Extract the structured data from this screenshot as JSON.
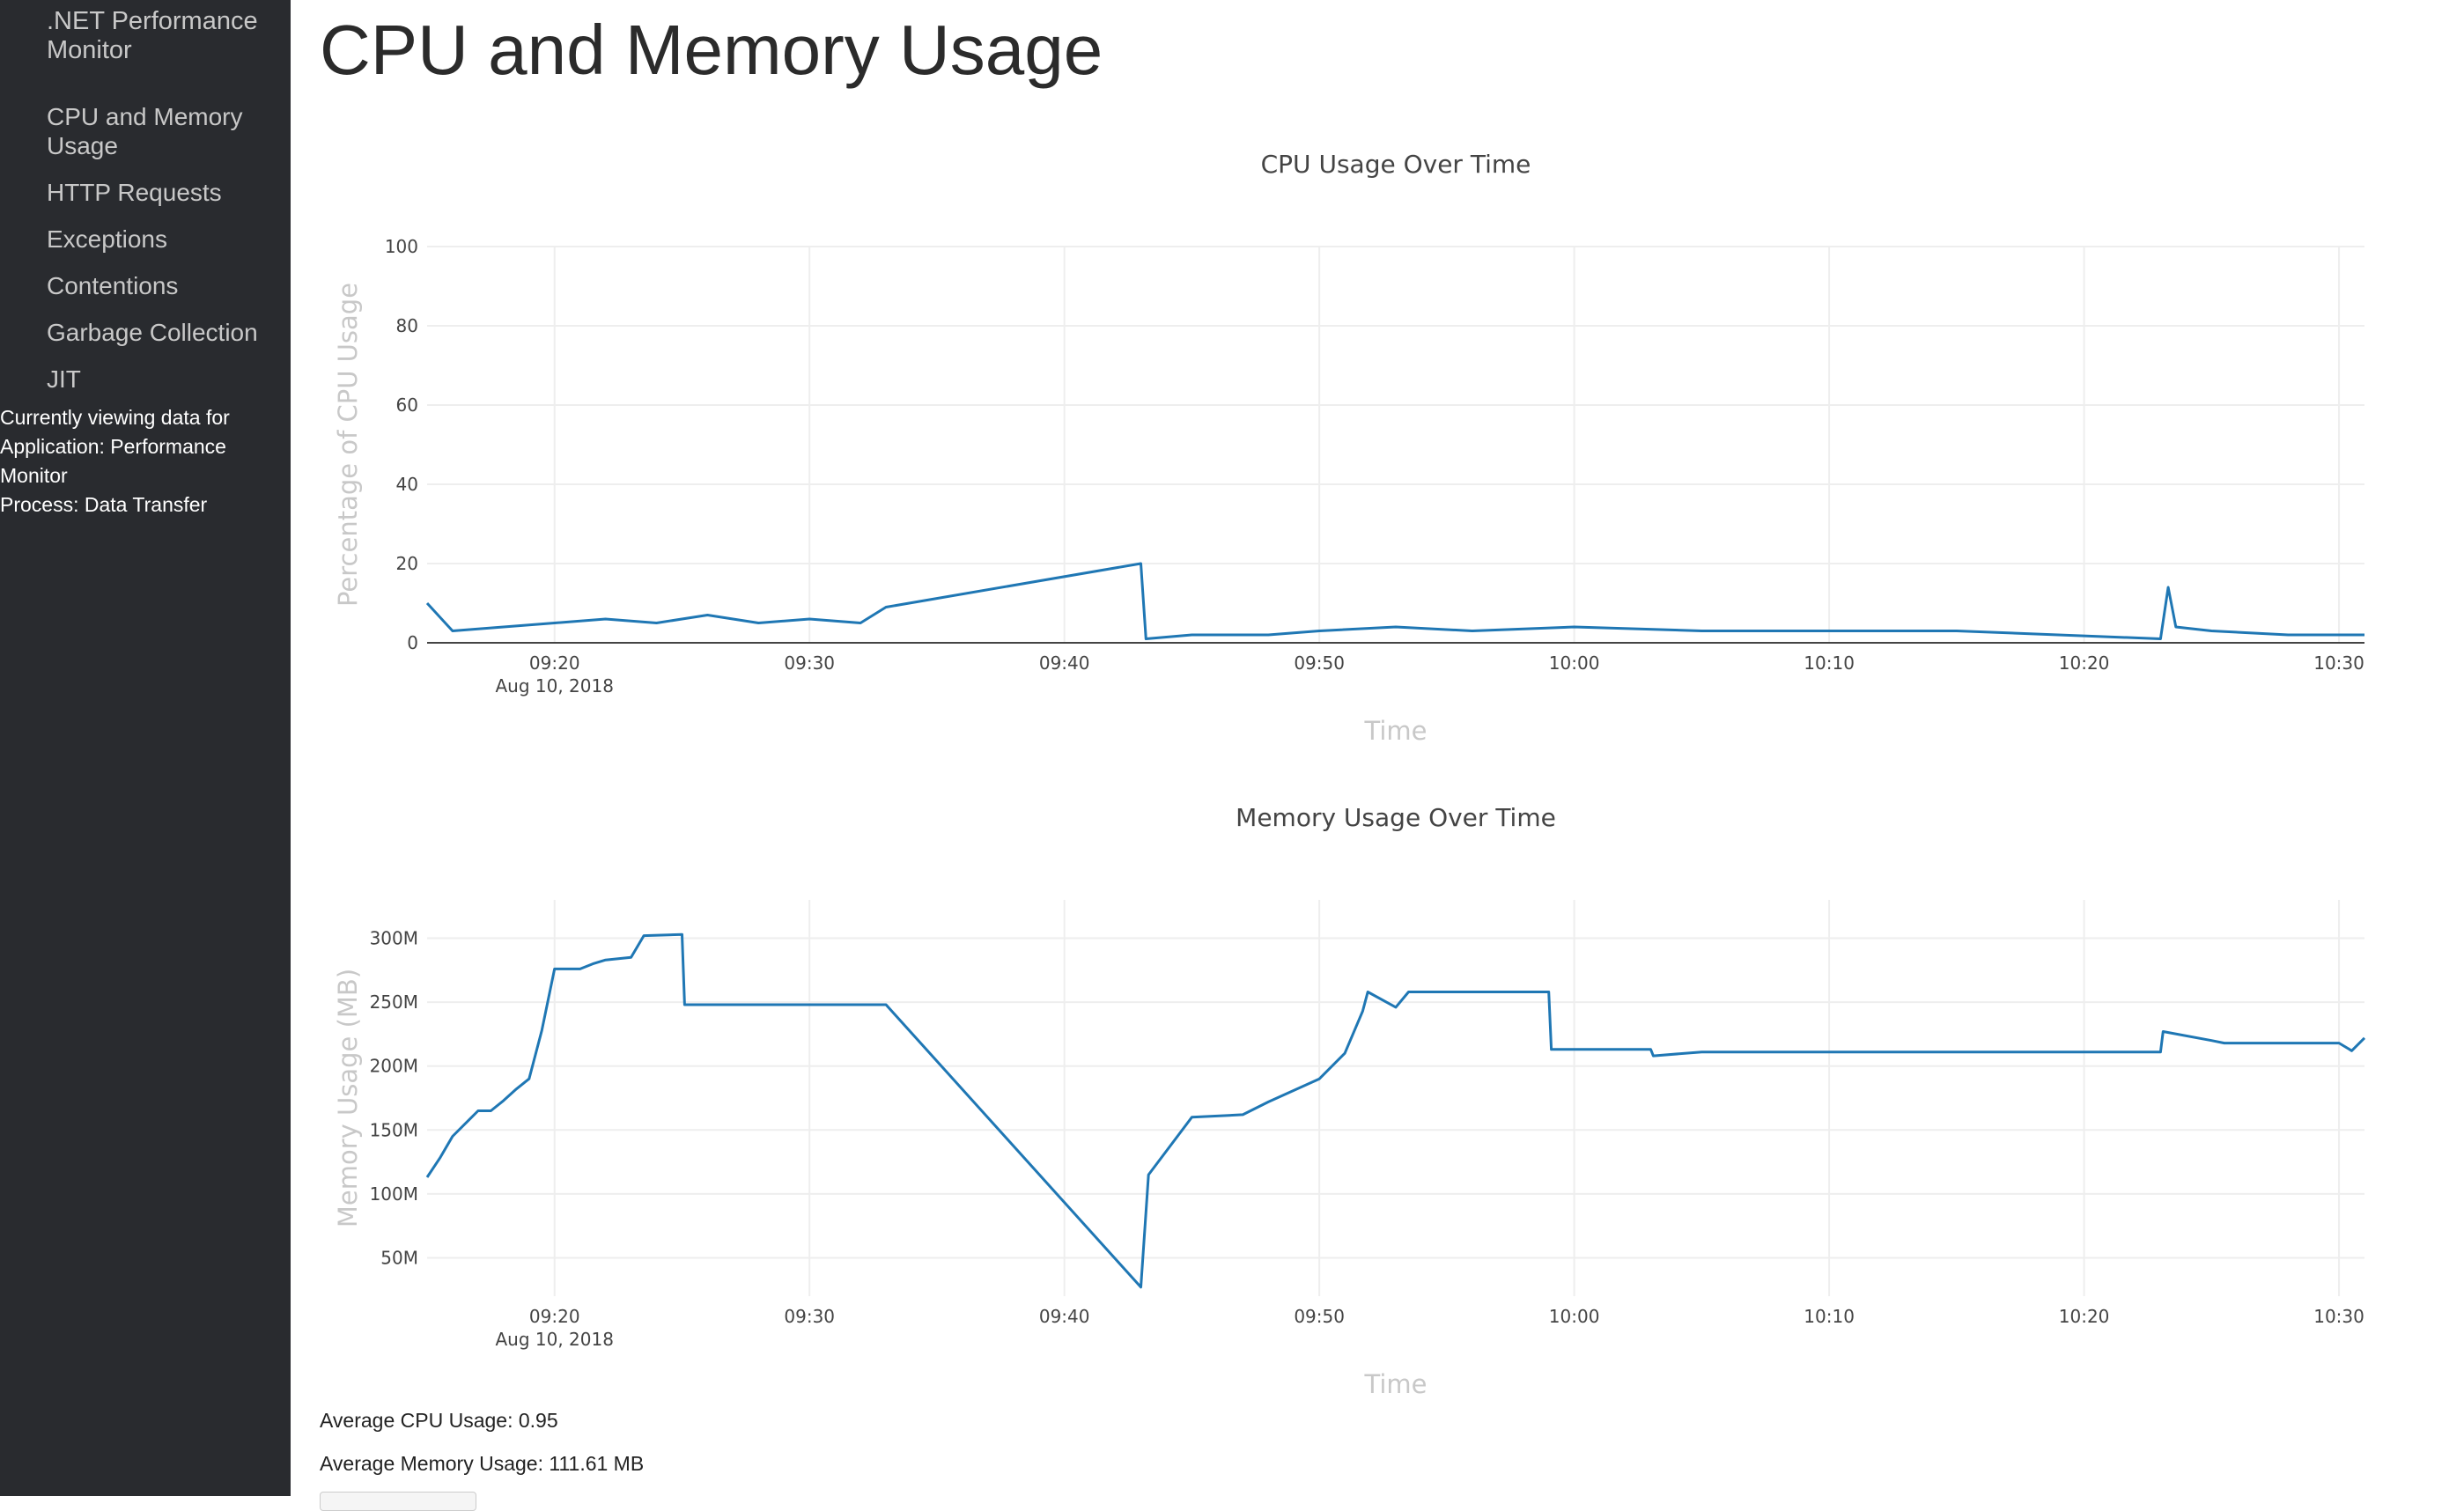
{
  "sidebar": {
    "title": ".NET Performance Monitor",
    "items": [
      {
        "label": "CPU and Memory Usage"
      },
      {
        "label": "HTTP Requests"
      },
      {
        "label": "Exceptions"
      },
      {
        "label": "Contentions"
      },
      {
        "label": "Garbage Collection"
      },
      {
        "label": "JIT"
      }
    ],
    "viewing": {
      "intro": "Currently viewing data for",
      "application": "Application: Performance Monitor",
      "process": "Process: Data Transfer"
    }
  },
  "page": {
    "title": "CPU and Memory Usage"
  },
  "summary": {
    "avg_cpu": "Average CPU Usage: 0.95",
    "avg_mem": "Average Memory Usage: 111.61 MB"
  },
  "colors": {
    "line": "#1f77b4",
    "sidebar_bg": "#292b2f"
  },
  "chart_data": [
    {
      "type": "line",
      "title": "CPU Usage Over Time",
      "xlabel": "Time",
      "ylabel": "Percentage of CPU Usage",
      "xlim": [
        "09:15",
        "10:31"
      ],
      "ylim": [
        0,
        100
      ],
      "yticks": [
        "0",
        "20",
        "40",
        "60",
        "80",
        "100"
      ],
      "xticks": [
        "09:20",
        "09:30",
        "09:40",
        "09:50",
        "10:00",
        "10:10",
        "10:20",
        "10:30"
      ],
      "date_label": "Aug 10, 2018",
      "grid": true,
      "series": [
        {
          "x": [
            "09:15",
            "09:16",
            "09:18",
            "09:20",
            "09:22",
            "09:24",
            "09:26",
            "09:28",
            "09:30",
            "09:32",
            "09:33",
            "09:43",
            "09:43.2",
            "09:45",
            "09:48",
            "09:50",
            "09:53",
            "09:56",
            "10:00",
            "10:05",
            "10:10",
            "10:15",
            "10:23",
            "10:23.3",
            "10:23.6",
            "10:25",
            "10:28",
            "10:31"
          ],
          "y": [
            10,
            3,
            4,
            5,
            6,
            5,
            7,
            5,
            6,
            5,
            9,
            20,
            1,
            2,
            2,
            3,
            4,
            3,
            4,
            3,
            3,
            3,
            1,
            14,
            4,
            3,
            2,
            2
          ]
        }
      ]
    },
    {
      "type": "line",
      "title": "Memory Usage Over Time",
      "xlabel": "Time",
      "ylabel": "Memory Usage (MB)",
      "xlim": [
        "09:15",
        "10:31"
      ],
      "ylim": [
        20,
        330
      ],
      "yticks": [
        "50M",
        "100M",
        "150M",
        "200M",
        "250M",
        "300M"
      ],
      "xticks": [
        "09:20",
        "09:30",
        "09:40",
        "09:50",
        "10:00",
        "10:10",
        "10:20",
        "10:30"
      ],
      "date_label": "Aug 10, 2018",
      "grid": true,
      "series": [
        {
          "x": [
            "09:15",
            "09:15.5",
            "09:16",
            "09:17",
            "09:17.5",
            "09:18",
            "09:18.5",
            "09:19",
            "09:19.5",
            "09:20",
            "09:21",
            "09:21.5",
            "09:22",
            "09:23",
            "09:23.5",
            "09:25",
            "09:25.1",
            "09:33",
            "09:43",
            "09:43.3",
            "09:45",
            "09:47",
            "09:48",
            "09:50",
            "09:51",
            "09:51.7",
            "09:51.9",
            "09:53",
            "09:53.5",
            "09:59",
            "09:59.1",
            "10:03",
            "10:03.1",
            "10:05",
            "10:23",
            "10:23.1",
            "10:25",
            "10:25.5",
            "10:30",
            "10:30.5",
            "10:31"
          ],
          "y": [
            113,
            128,
            145,
            165,
            165,
            173,
            182,
            190,
            228,
            276,
            276,
            280,
            283,
            285,
            302,
            303,
            248,
            248,
            27,
            115,
            160,
            162,
            172,
            190,
            210,
            243,
            258,
            246,
            258,
            258,
            213,
            213,
            208,
            211,
            211,
            227,
            220,
            218,
            218,
            212,
            222
          ]
        }
      ]
    }
  ]
}
